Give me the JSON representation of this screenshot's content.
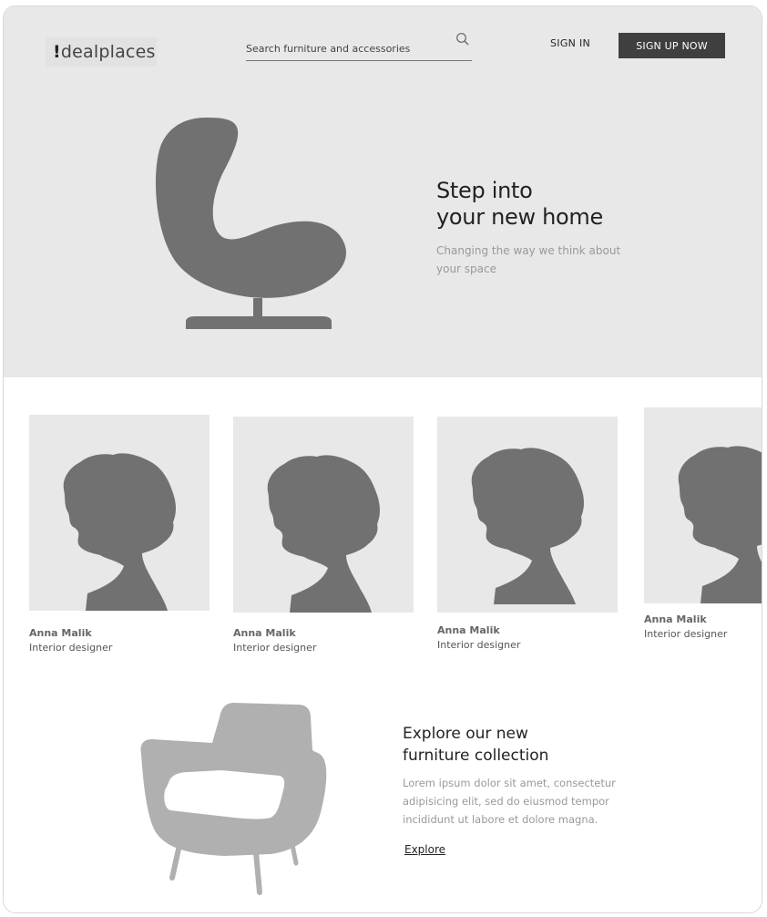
{
  "header": {
    "logo_mark": "!",
    "logo_text": "dealplaces",
    "search_placeholder": "Search furniture and accessories",
    "signin_label": "SIGN IN",
    "signup_label": "SIGN UP NOW"
  },
  "hero": {
    "title_line1": "Step into",
    "title_line2": "your new home",
    "subtitle": "Changing the way we think about your space"
  },
  "designers": [
    {
      "name": "Anna Malik",
      "role": "Interior designer"
    },
    {
      "name": "Anna Malik",
      "role": "Interior designer"
    },
    {
      "name": "Anna Malik",
      "role": "Interior designer"
    },
    {
      "name": "Anna Malik",
      "role": "Interior designer"
    }
  ],
  "explore": {
    "title_line1": "Explore our new",
    "title_line2": "furniture collection",
    "body": "Lorem ipsum dolor sit amet, consectetur adipisicing elit, sed do eiusmod tempor incididunt ut labore et dolore magna.",
    "link_label": "Explore"
  },
  "colors": {
    "hero_bg": "#e8e8e8",
    "button_bg": "#3f3f3f",
    "silhouette": "#717171",
    "chair_light": "#b0b0b0"
  },
  "icons": {
    "search": "search-icon",
    "egg_chair": "egg-chair-illustration",
    "armchair": "armchair-illustration",
    "profile": "profile-silhouette"
  }
}
